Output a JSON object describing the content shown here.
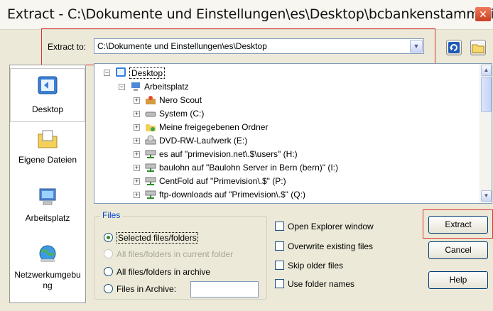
{
  "window": {
    "title": "Extract - C:\\Dokumente und Einstellungen\\es\\Desktop\\bcbankenstamm.zip",
    "close_glyph": "✕"
  },
  "extract_to": {
    "label": "Extract to:",
    "path": "C:\\Dokumente und Einstellungen\\es\\Desktop"
  },
  "toolbar": {
    "icons": [
      "refresh-folder-icon",
      "open-folder-icon"
    ]
  },
  "places": [
    {
      "label": "Desktop",
      "icon": "desktop-icon"
    },
    {
      "label": "Eigene Dateien",
      "icon": "documents-folder-icon"
    },
    {
      "label": "Arbeitsplatz",
      "icon": "computer-icon"
    },
    {
      "label": "Netzwerkumgebu ng",
      "icon": "network-icon"
    }
  ],
  "tree": [
    {
      "label": "Desktop",
      "icon": "desktop-icon",
      "expanded": true,
      "selected": true
    },
    {
      "label": "Arbeitsplatz",
      "icon": "computer-icon",
      "expanded": true
    },
    {
      "label": "Nero Scout",
      "icon": "nero-scout-icon"
    },
    {
      "label": "System (C:)",
      "icon": "hard-drive-icon"
    },
    {
      "label": "Meine freigegebenen Ordner",
      "icon": "shared-folder-icon"
    },
    {
      "label": "DVD-RW-Laufwerk (E:)",
      "icon": "dvd-drive-icon"
    },
    {
      "label": "es auf \"primevision.net\\.$\\users\" (H:)",
      "icon": "network-drive-icon"
    },
    {
      "label": "baulohn auf \"Baulohn Server in Bern (bern)\" (I:)",
      "icon": "network-drive-icon"
    },
    {
      "label": "CentFold auf \"Primevision\\.$\" (P:)",
      "icon": "network-drive-icon"
    },
    {
      "label": "ftp-downloads auf \"Primevision\\.$\" (Q:)",
      "icon": "network-drive-icon"
    }
  ],
  "files": {
    "legend": "Files",
    "options": [
      {
        "label": "Selected files/folders",
        "checked": true,
        "enabled": true
      },
      {
        "label": "All files/folders in current folder",
        "checked": false,
        "enabled": false
      },
      {
        "label": "All files/folders in archive",
        "checked": false,
        "enabled": true
      },
      {
        "label": "Files in Archive:",
        "checked": false,
        "enabled": true
      }
    ],
    "archive_filter_value": ""
  },
  "options": [
    {
      "label": "Open Explorer window",
      "checked": false
    },
    {
      "label": "Overwrite existing files",
      "checked": false
    },
    {
      "label": "Skip older files",
      "checked": false
    },
    {
      "label": "Use folder names",
      "checked": false
    }
  ],
  "buttons": {
    "extract": "Extract",
    "cancel": "Cancel",
    "help": "Help"
  },
  "colors": {
    "highlight": "#d9352f",
    "group_title": "#0046d5"
  }
}
